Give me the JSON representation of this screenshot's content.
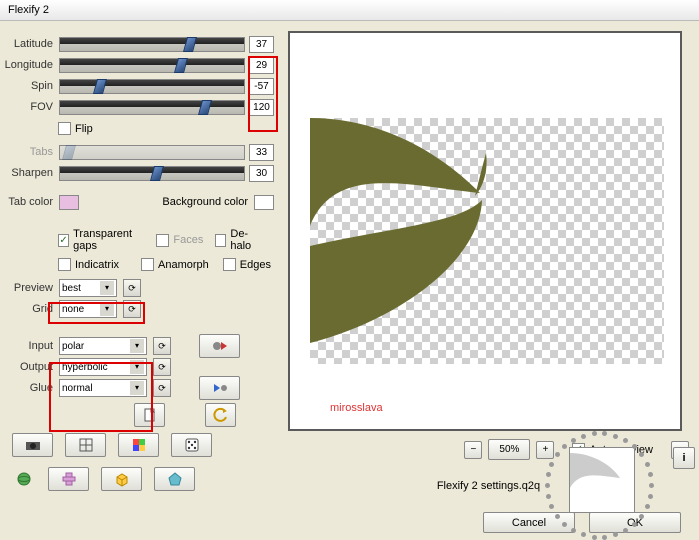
{
  "window_title": "Flexify 2",
  "sliders": {
    "latitude": {
      "label": "Latitude",
      "value": "37",
      "thumb_pct": 68
    },
    "longitude": {
      "label": "Longitude",
      "value": "29",
      "thumb_pct": 63
    },
    "spin": {
      "label": "Spin",
      "value": "-57",
      "thumb_pct": 19
    },
    "fov": {
      "label": "FOV",
      "value": "120",
      "thumb_pct": 76
    },
    "tabs": {
      "label": "Tabs",
      "value": "33",
      "thumb_pct": 2
    },
    "sharpen": {
      "label": "Sharpen",
      "value": "30",
      "thumb_pct": 50
    }
  },
  "flip": {
    "label": "Flip",
    "checked": false
  },
  "tab_color": {
    "label": "Tab color",
    "color": "#e8bfe0"
  },
  "bg_color": {
    "label": "Background color",
    "color": "#ffffff"
  },
  "checks": {
    "transparent_gaps": {
      "label": "Transparent gaps",
      "checked": true
    },
    "faces": {
      "label": "Faces",
      "checked": false,
      "disabled": true
    },
    "dehalo": {
      "label": "De-halo",
      "checked": false
    },
    "indicatrix": {
      "label": "Indicatrix",
      "checked": false
    },
    "anamorph": {
      "label": "Anamorph",
      "checked": false
    },
    "edges": {
      "label": "Edges",
      "checked": false
    }
  },
  "preview": {
    "label": "Preview",
    "value": "best"
  },
  "grid": {
    "label": "Grid",
    "value": "none"
  },
  "input": {
    "label": "Input",
    "value": "polar"
  },
  "output": {
    "label": "Output",
    "value": "hyperbolic"
  },
  "glue": {
    "label": "Glue",
    "value": "normal"
  },
  "watermark": "mirosslava",
  "zoom": {
    "value": "50%"
  },
  "auto_preview": {
    "label": "Auto preview",
    "checked": true
  },
  "settings_file": "Flexify 2 settings.q2q",
  "buttons": {
    "cancel": "Cancel",
    "ok": "OK"
  }
}
